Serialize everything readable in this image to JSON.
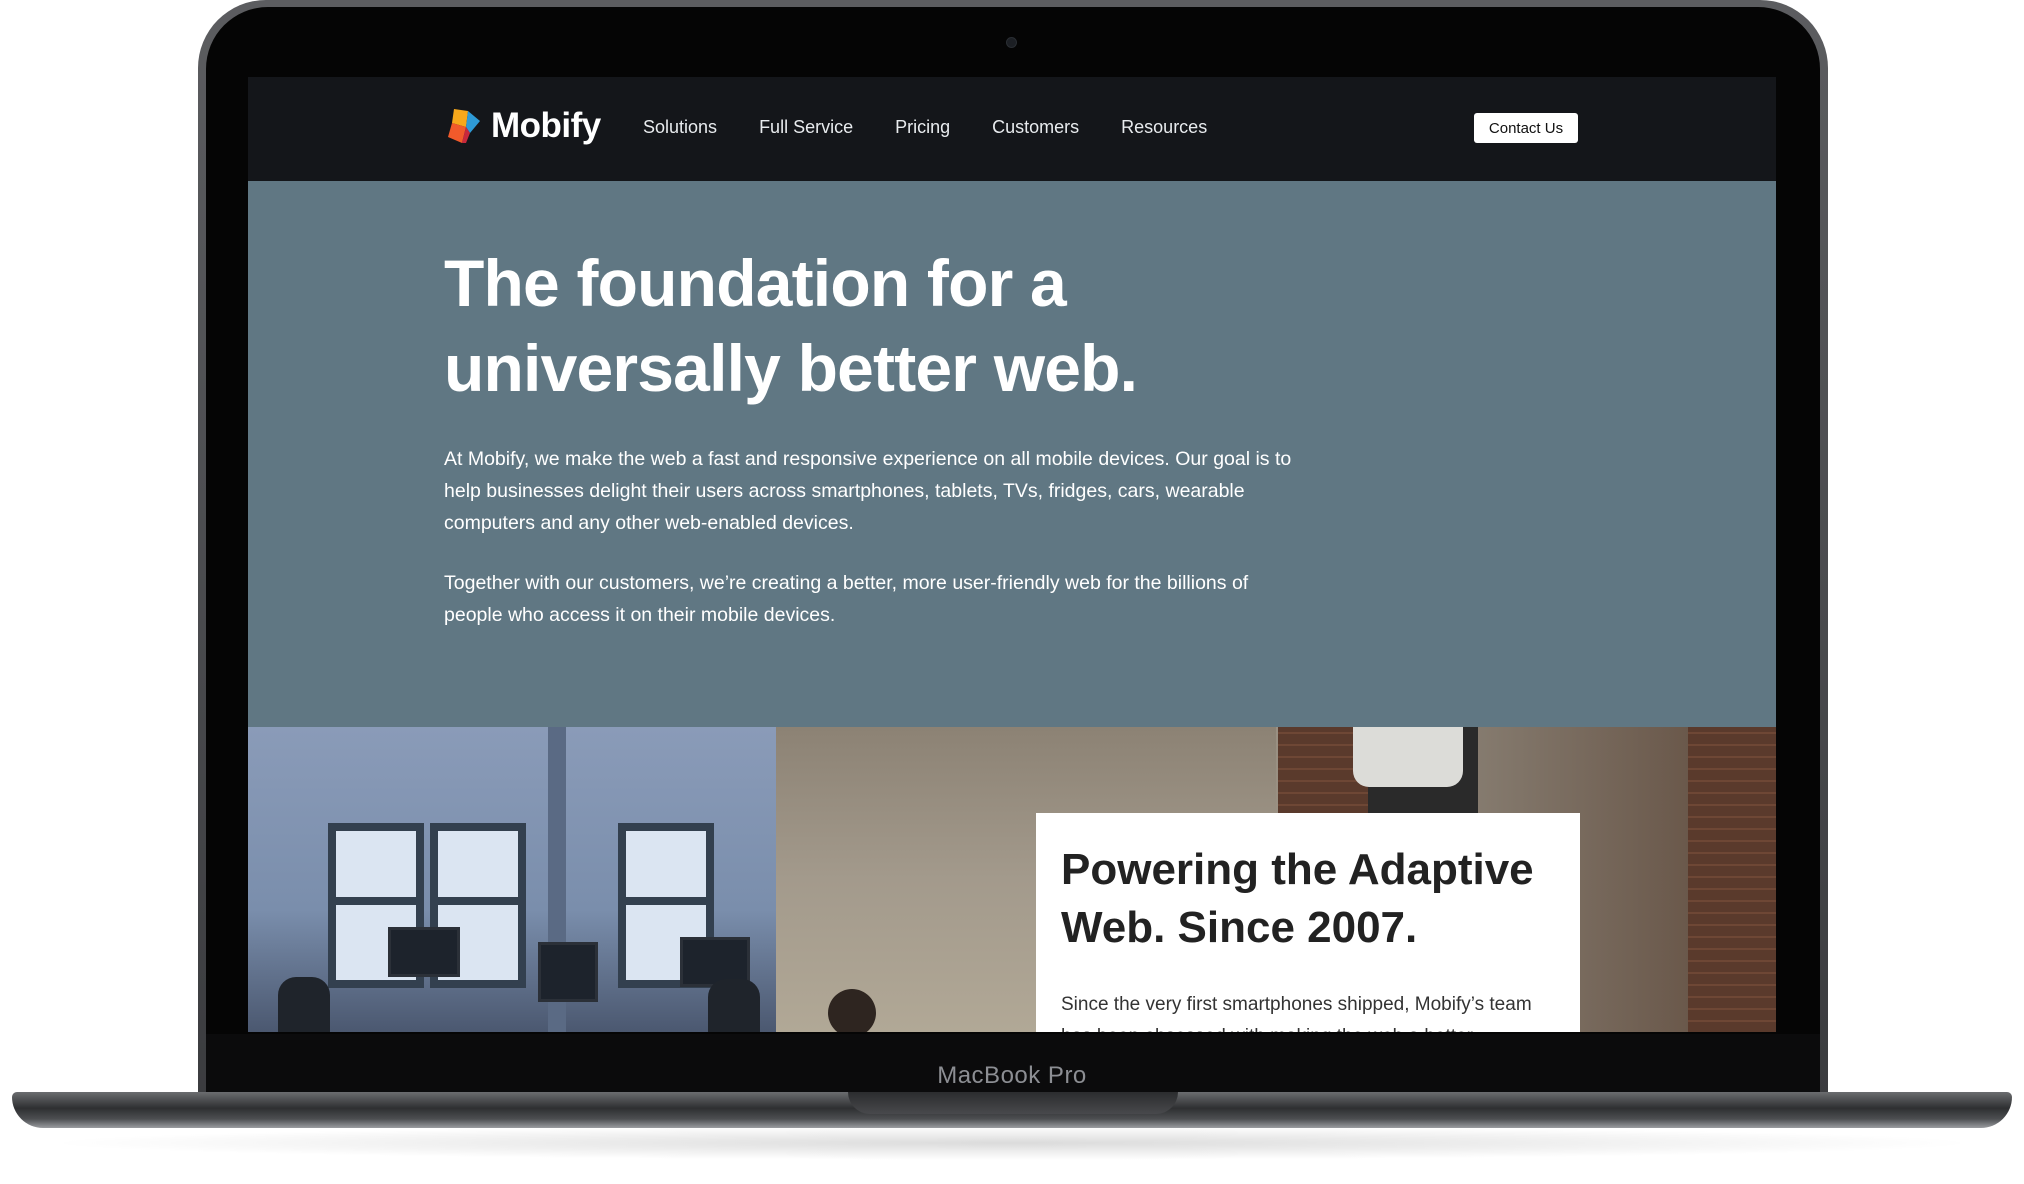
{
  "device": {
    "model_label": "MacBook Pro"
  },
  "brand": {
    "name": "Mobify",
    "logo_icon": "mobify-logo-icon",
    "colors": {
      "nav_bg": "#14161a",
      "hero_bg": "#607783",
      "logo_orange": "#f15a2b",
      "logo_blue": "#2e9ad6",
      "logo_red": "#c8283c",
      "logo_yellow": "#f7a81b"
    }
  },
  "nav": {
    "items": [
      {
        "label": "Solutions"
      },
      {
        "label": "Full Service"
      },
      {
        "label": "Pricing"
      },
      {
        "label": "Customers"
      },
      {
        "label": "Resources"
      }
    ],
    "contact_label": "Contact Us"
  },
  "hero": {
    "title": "The foundation for a universally better web.",
    "paragraph_1": "At Mobify, we make the web a fast and responsive experience on all mobile devices. Our goal is to help businesses delight their users across smartphones, tablets, TVs, fridges, cars, wearable computers and any other web-enabled devices.",
    "paragraph_2": "Together with our customers, we’re creating a better, more user-friendly web for the billions of people who access it on their mobile devices."
  },
  "feature_card": {
    "title": "Powering the Adaptive Web. Since 2007.",
    "body": "Since the very first smartphones shipped, Mobify’s team has been obsessed with making the web a better"
  }
}
